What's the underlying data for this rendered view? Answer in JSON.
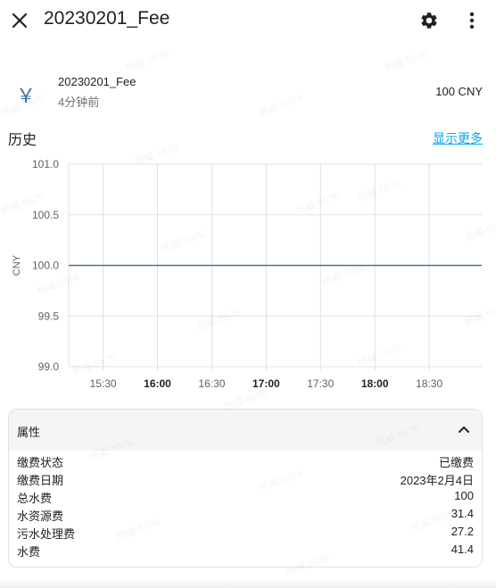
{
  "header": {
    "title": "20230201_Fee",
    "close_icon": "close-icon",
    "settings_icon": "gear-icon",
    "more_icon": "more-vertical-icon"
  },
  "entity": {
    "icon": "￥",
    "name": "20230201_Fee",
    "last_changed": "4分钟前",
    "value": "100 CNY"
  },
  "history": {
    "title": "历史",
    "more_link": "显示更多"
  },
  "chart_data": {
    "type": "line",
    "ylabel": "CNY",
    "ylim": [
      99.0,
      101.0
    ],
    "yticks": [
      "101.0",
      "100.5",
      "100.0",
      "99.5",
      "99.0"
    ],
    "xticks": [
      {
        "label": "15:30",
        "bold": false
      },
      {
        "label": "16:00",
        "bold": true
      },
      {
        "label": "16:30",
        "bold": false
      },
      {
        "label": "17:00",
        "bold": true
      },
      {
        "label": "17:30",
        "bold": false
      },
      {
        "label": "18:00",
        "bold": true
      },
      {
        "label": "18:30",
        "bold": false
      }
    ],
    "series": [
      {
        "x": [
          "15:11",
          "18:59"
        ],
        "values": [
          100,
          100
        ],
        "color": "#44739e"
      }
    ],
    "grid": true
  },
  "attributes": {
    "header": "属性",
    "rows": [
      {
        "key": "缴费状态",
        "value": "已缴费"
      },
      {
        "key": "缴费日期",
        "value": "2023年2月4日"
      },
      {
        "key": "总水费",
        "value": "100"
      },
      {
        "key": "水资源费",
        "value": "31.4"
      },
      {
        "key": "污水处理费",
        "value": "27.2"
      },
      {
        "key": "水费",
        "value": "41.4"
      }
    ]
  },
  "watermark": "杨威-5576",
  "colors": {
    "accent": "#03a9f4",
    "line": "#44739e",
    "grid": "#e0e0e0",
    "secondary_text": "#6f6f6f"
  }
}
